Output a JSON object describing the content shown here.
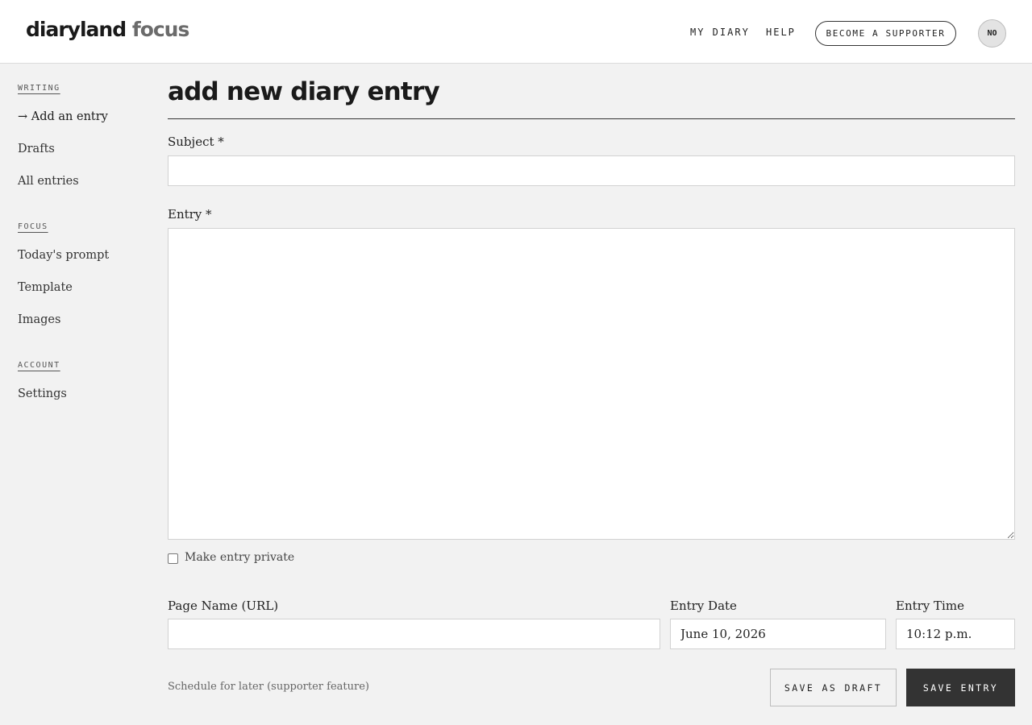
{
  "header": {
    "logo_main": "diaryland",
    "logo_sub": "focus",
    "nav": {
      "my_diary": "MY DIARY",
      "help": "HELP"
    },
    "support_button": "BECOME A SUPPORTER",
    "avatar_initials": "NO"
  },
  "sidebar": {
    "sections": [
      {
        "heading": "WRITING",
        "items": [
          "→ Add an entry",
          "Drafts",
          "All entries"
        ]
      },
      {
        "heading": "FOCUS",
        "items": [
          "Today's prompt",
          "Template",
          "Images"
        ]
      },
      {
        "heading": "ACCOUNT",
        "items": [
          "Settings"
        ]
      }
    ],
    "active_item": "→ Add an entry"
  },
  "main": {
    "title": "add new diary entry",
    "subject": {
      "label": "Subject *",
      "value": ""
    },
    "entry": {
      "label": "Entry *",
      "value": ""
    },
    "private_checkbox": {
      "label": "Make entry private",
      "checked": false
    },
    "page_name": {
      "label": "Page Name (URL)",
      "value": ""
    },
    "entry_date": {
      "label": "Entry Date",
      "value": "June 10, 2026"
    },
    "entry_time": {
      "label": "Entry Time",
      "value": "10:12 p.m."
    },
    "schedule_link": "Schedule for later (supporter feature)",
    "save_draft_button": "SAVE AS DRAFT",
    "save_entry_button": "SAVE ENTRY"
  }
}
